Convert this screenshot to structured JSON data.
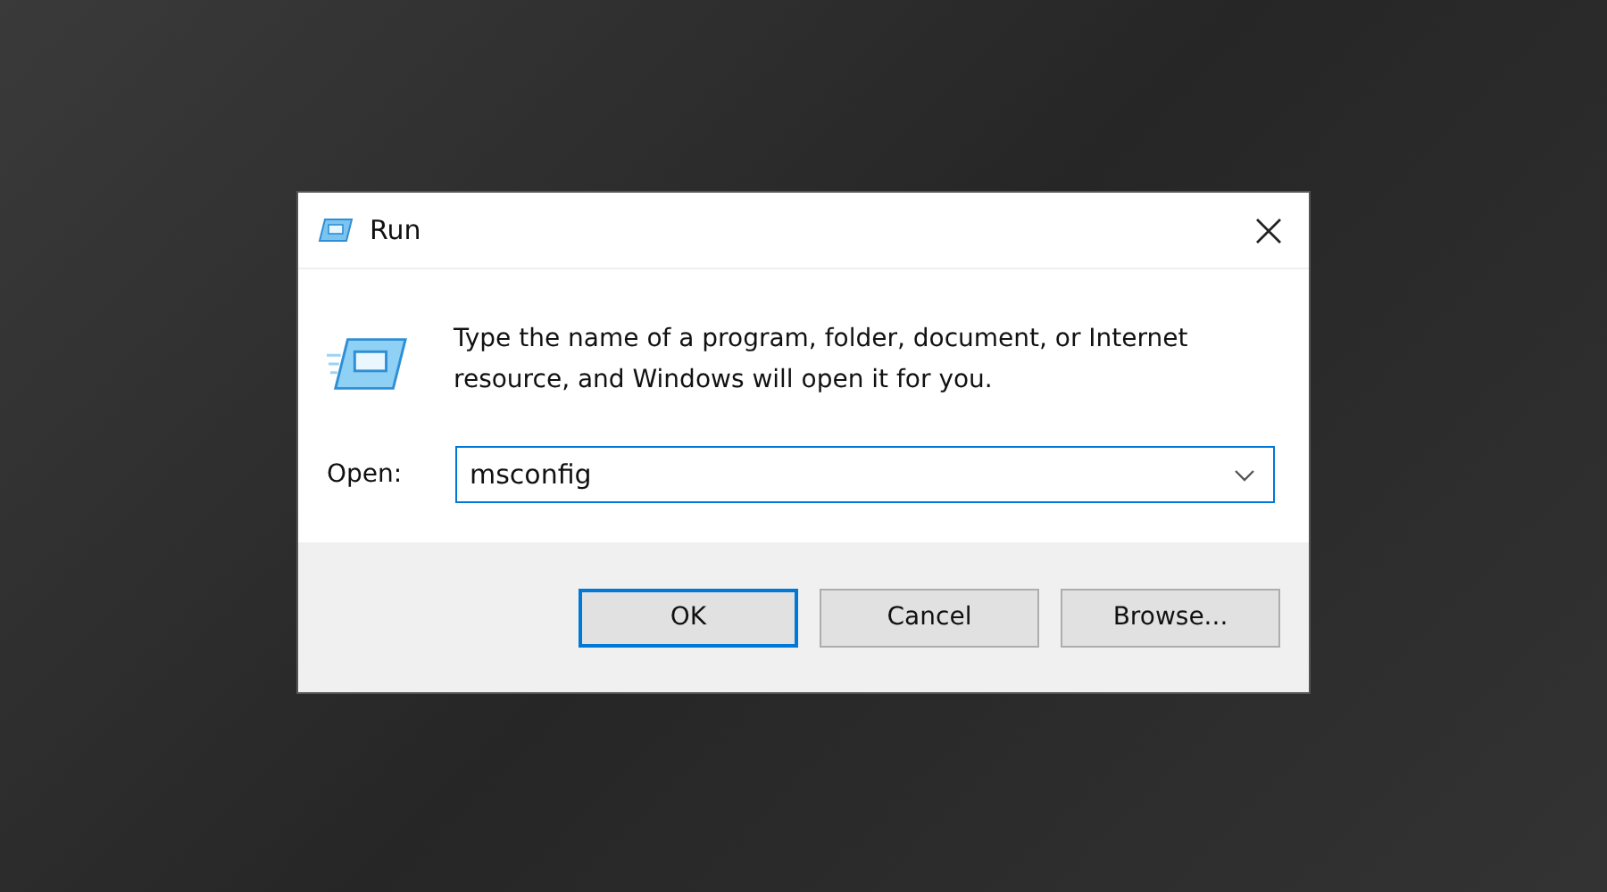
{
  "window": {
    "title": "Run"
  },
  "message": "Type the name of a program, folder, document, or Internet resource, and Windows will open it for you.",
  "open_field": {
    "label": "Open:",
    "value": "msconfig"
  },
  "buttons": [
    {
      "label": "OK",
      "default": true
    },
    {
      "label": "Cancel",
      "default": false
    },
    {
      "label": "Browse...",
      "default": false
    }
  ]
}
